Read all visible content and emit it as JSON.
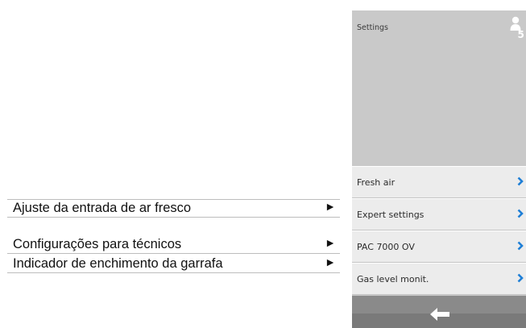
{
  "annotations": [
    {
      "text": "Ajuste da entrada de ar fresco",
      "arrow": "►"
    },
    {
      "text": "Configurações para técnicos",
      "arrow": "►"
    },
    {
      "text": "Indicador de enchimento da garrafa",
      "arrow": "►"
    }
  ],
  "screen": {
    "title": "Settings",
    "user_icon": "user-level-icon",
    "user_level": "5",
    "menu": [
      {
        "label": "Fresh air",
        "icon": "chevron-right-icon"
      },
      {
        "label": "Expert settings",
        "icon": "chevron-right-icon"
      },
      {
        "label": "PAC 7000 OV",
        "icon": "chevron-right-icon"
      },
      {
        "label": "Gas level monit.",
        "icon": "chevron-right-icon"
      }
    ],
    "footer": {
      "back_icon": "back-arrow-icon"
    }
  },
  "colors": {
    "accent": "#1f7fd6",
    "screen_bg": "#c9c9c9",
    "menu_bg": "#ececec",
    "footer_bg": "#7a7a7a"
  }
}
